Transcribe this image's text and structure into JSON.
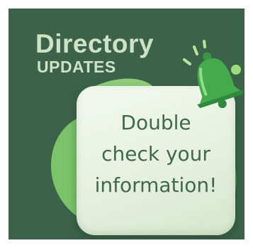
{
  "banner": {
    "title": "Directory",
    "subtitle": "UPDATES",
    "message_lines": [
      "Double",
      "check your",
      "information!"
    ]
  },
  "icons": {
    "bell": "notification-bell-icon"
  },
  "colors": {
    "background": "#3c634a",
    "title_text": "#cfe2c5",
    "card": "#eaf2e4",
    "message_text": "#3f6a48",
    "blob_light": "#7cc46b",
    "blob_dark": "#4f9a4e",
    "bell": "#3fa64a"
  }
}
